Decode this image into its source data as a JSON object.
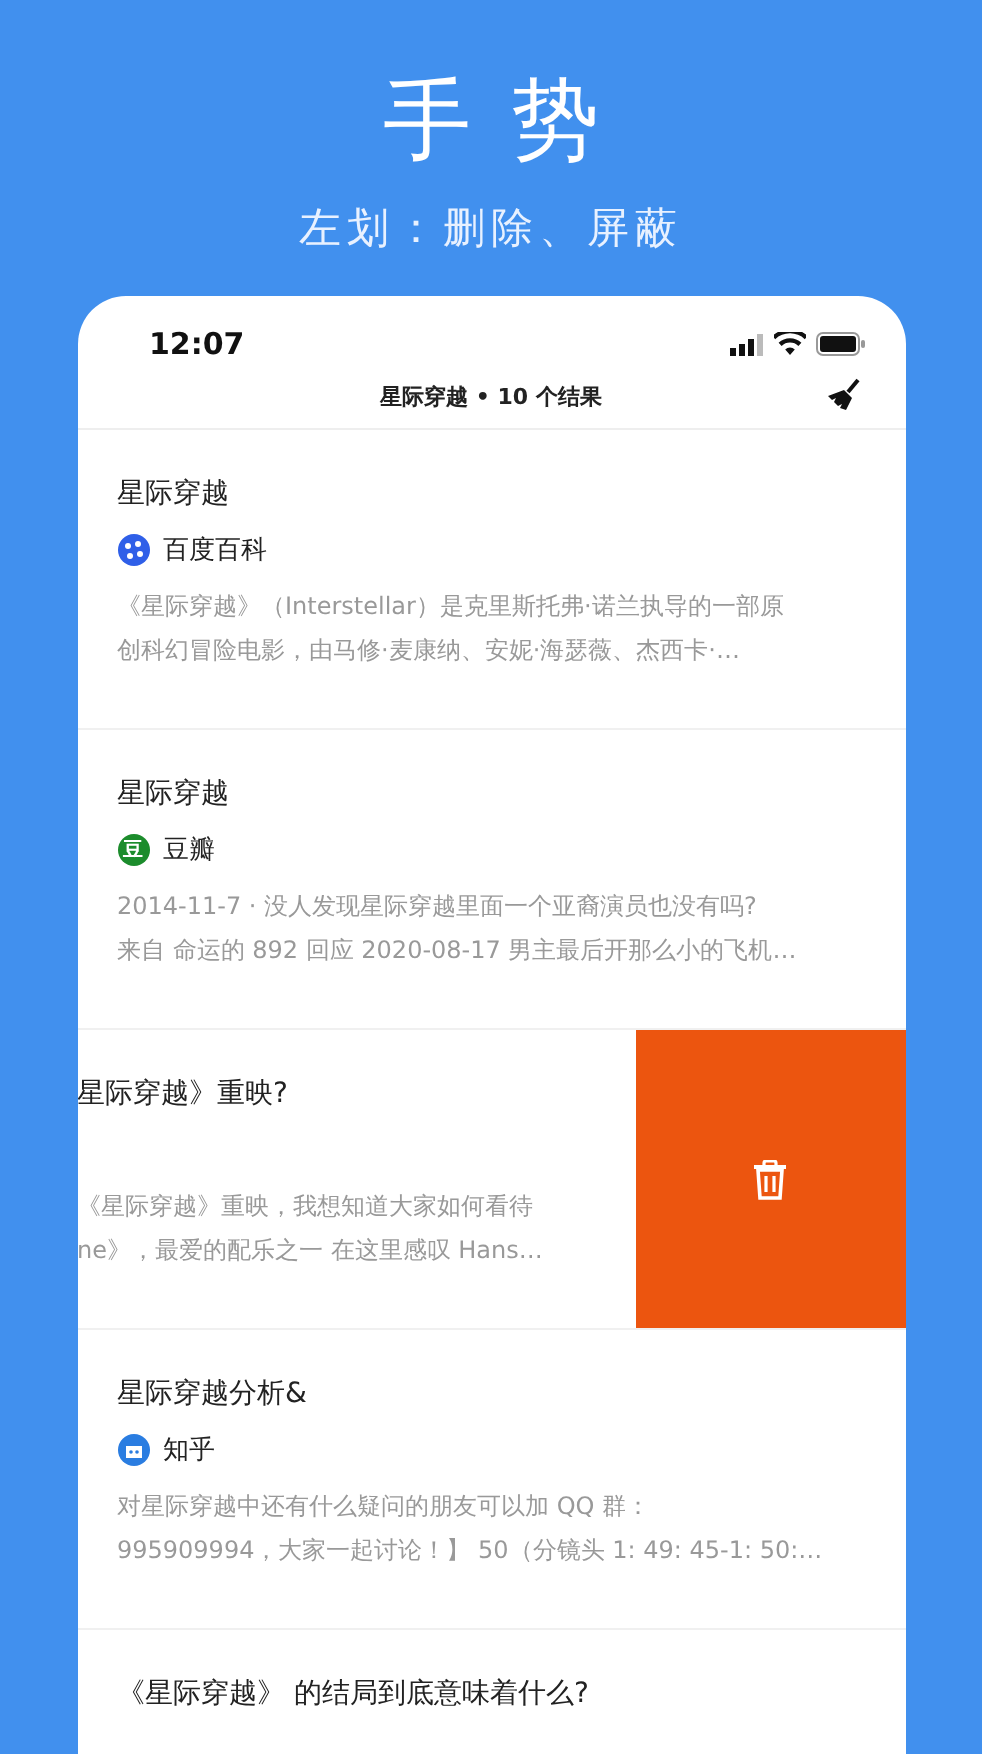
{
  "heading": "手势",
  "subheading": "左划：删除、屏蔽",
  "status_bar": {
    "time": "12:07"
  },
  "nav": {
    "title": "星际穿越 • 10 个结果"
  },
  "results": [
    {
      "title": "星际穿越",
      "source": {
        "kind": "baidu",
        "name": "百度百科"
      },
      "snippet": [
        "《星际穿越》（Interstellar）是克里斯托弗·诺兰执导的一部原",
        "创科幻冒险电影，由马修·麦康纳、安妮·海瑟薇、杰西卡·…"
      ],
      "swiped": false
    },
    {
      "title": "星际穿越",
      "source": {
        "kind": "douban",
        "name": "豆瓣",
        "glyph": "豆"
      },
      "snippet": [
        "2014-11-7 · 没人发现星际穿越里面一个亚裔演员也没有吗?",
        "来自 命运的 892 回应 2020-08-17 男主最后开那么小的飞机…"
      ],
      "swiped": false
    },
    {
      "title": "星际穿越》重映?",
      "snippet": [
        "《星际穿越》重映，我想知道大家如何看待",
        "ne》，最爱的配乐之一 在这里感叹 Hans…"
      ],
      "swiped": true
    },
    {
      "title": "星际穿越分析&",
      "source": {
        "kind": "zhihu",
        "name": "知乎"
      },
      "snippet": [
        "对星际穿越中还有什么疑问的朋友可以加 QQ 群：",
        "995909994，大家一起讨论！】 50（分镜头 1: 49: 45-1: 50:…"
      ],
      "swiped": false
    },
    {
      "title": "《星际穿越》 的结局到底意味着什么?",
      "swiped": false
    }
  ]
}
